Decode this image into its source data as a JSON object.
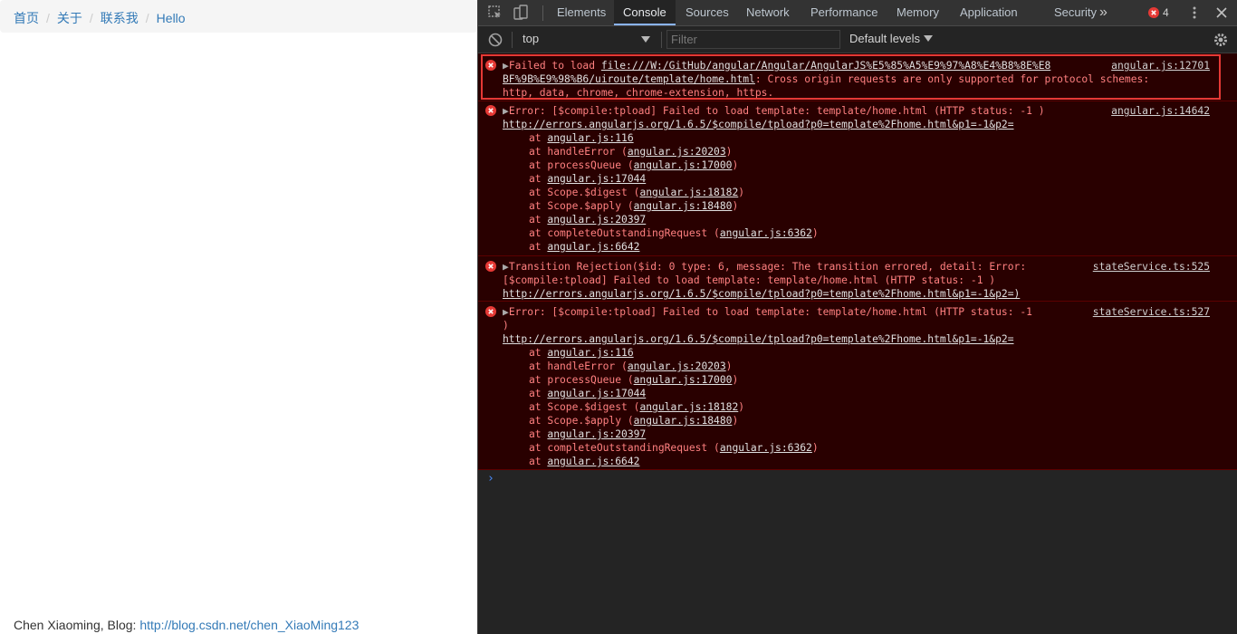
{
  "page": {
    "breadcrumb": [
      "首页",
      "关于",
      "联系我",
      "Hello"
    ],
    "separator": "/",
    "footer_text": "Chen Xiaoming, Blog: ",
    "footer_link": "http://blog.csdn.net/chen_XiaoMing123"
  },
  "devtools": {
    "tabs": [
      "Elements",
      "Console",
      "Sources",
      "Network",
      "Performance",
      "Memory",
      "Application",
      "Security"
    ],
    "more_tabs": "»",
    "error_count": "4",
    "context": "top",
    "filter_placeholder": "Filter",
    "levels": "Default levels",
    "accent_color": "#8ab4f8",
    "error_color": "#ff8080"
  },
  "console": {
    "messages": [
      {
        "source": "angular.js:12701",
        "lines": [
          [
            "Failed to load ",
            "file:///W:/GitHub/angular/Angular/AngularJS%E5%85%A5%E9%97%A8%E4%B8%8E%E8"
          ],
          [
            "BF%9B%E9%98%B6/uiroute/template/home.html",
            ": Cross origin requests are only supported for protocol schemes:"
          ],
          [
            "http, data, chrome, chrome-extension, https."
          ]
        ]
      },
      {
        "source": "angular.js:14642",
        "head": "Error: [$compile:tpload] Failed to load template: template/home.html (HTTP status: -1 )",
        "url": "http://errors.angularjs.org/1.6.5/$compile/tpload?p0=template%2Fhome.html&p1=-1&p2=",
        "stack": [
          [
            "at ",
            "angular.js:116",
            ""
          ],
          [
            "at handleError (",
            "angular.js:20203",
            ")"
          ],
          [
            "at processQueue (",
            "angular.js:17000",
            ")"
          ],
          [
            "at ",
            "angular.js:17044",
            ""
          ],
          [
            "at Scope.$digest (",
            "angular.js:18182",
            ")"
          ],
          [
            "at Scope.$apply (",
            "angular.js:18480",
            ")"
          ],
          [
            "at ",
            "angular.js:20397",
            ""
          ],
          [
            "at completeOutstandingRequest (",
            "angular.js:6362",
            ")"
          ],
          [
            "at ",
            "angular.js:6642",
            ""
          ]
        ]
      },
      {
        "source": "stateService.ts:525",
        "lines": [
          "Transition Rejection($id: 0 type: 6, message: The transition errored, detail: Error:",
          "[$compile:tpload] Failed to load template: template/home.html (HTTP status: -1 )",
          "http://errors.angularjs.org/1.6.5/$compile/tpload?p0=template%2Fhome.html&p1=-1&p2=)"
        ]
      },
      {
        "source": "stateService.ts:527",
        "head": "Error: [$compile:tpload] Failed to load template: template/home.html (HTTP status: -1",
        "head2": ")",
        "url": "http://errors.angularjs.org/1.6.5/$compile/tpload?p0=template%2Fhome.html&p1=-1&p2=",
        "stack": [
          [
            "at ",
            "angular.js:116",
            ""
          ],
          [
            "at handleError (",
            "angular.js:20203",
            ")"
          ],
          [
            "at processQueue (",
            "angular.js:17000",
            ")"
          ],
          [
            "at ",
            "angular.js:17044",
            ""
          ],
          [
            "at Scope.$digest (",
            "angular.js:18182",
            ")"
          ],
          [
            "at Scope.$apply (",
            "angular.js:18480",
            ")"
          ],
          [
            "at ",
            "angular.js:20397",
            ""
          ],
          [
            "at completeOutstandingRequest (",
            "angular.js:6362",
            ")"
          ],
          [
            "at ",
            "angular.js:6642",
            ""
          ]
        ]
      }
    ],
    "prompt": "›"
  }
}
